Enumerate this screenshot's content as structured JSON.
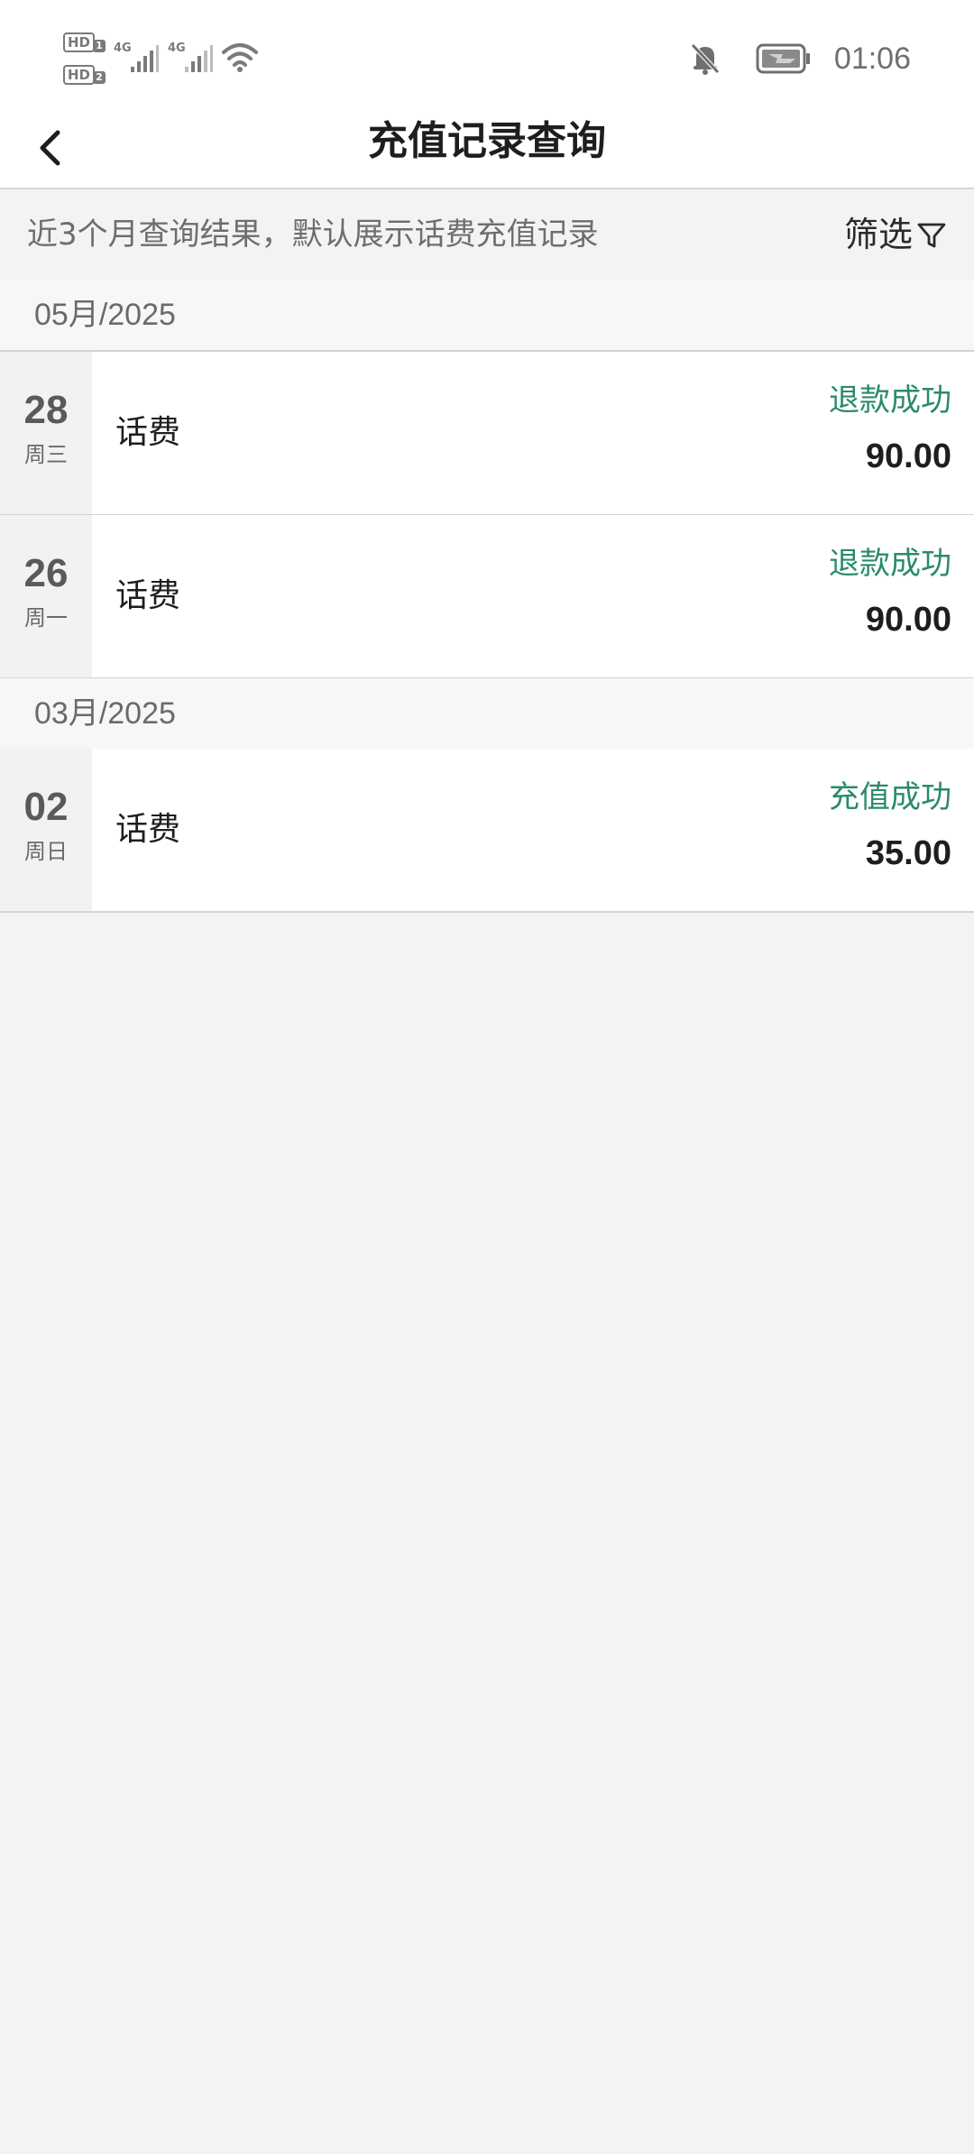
{
  "status_bar": {
    "sim1": "HD",
    "sim1_index": "1",
    "sim2": "HD",
    "sim2_index": "2",
    "net1": "4G",
    "net2": "4G",
    "time": "01:06",
    "icons": [
      "signal-icon",
      "wifi-icon",
      "mute-bell-icon",
      "battery-charging-icon"
    ]
  },
  "header": {
    "title": "充值记录查询",
    "back_icon": "chevron-left-icon"
  },
  "filter_bar": {
    "note": "近3个月查询结果，默认展示话费充值记录",
    "filter_label": "筛选",
    "filter_icon": "funnel-icon"
  },
  "groups": [
    {
      "month": "05月/2025",
      "records": [
        {
          "day": "28",
          "weekday": "周三",
          "type": "话费",
          "status": "退款成功",
          "amount": "90.00"
        },
        {
          "day": "26",
          "weekday": "周一",
          "type": "话费",
          "status": "退款成功",
          "amount": "90.00"
        }
      ]
    },
    {
      "month": "03月/2025",
      "records": [
        {
          "day": "02",
          "weekday": "周日",
          "type": "话费",
          "status": "充值成功",
          "amount": "35.00"
        }
      ]
    }
  ],
  "colors": {
    "status_green": "#2a8a6e",
    "background": "#f3f3f3"
  }
}
